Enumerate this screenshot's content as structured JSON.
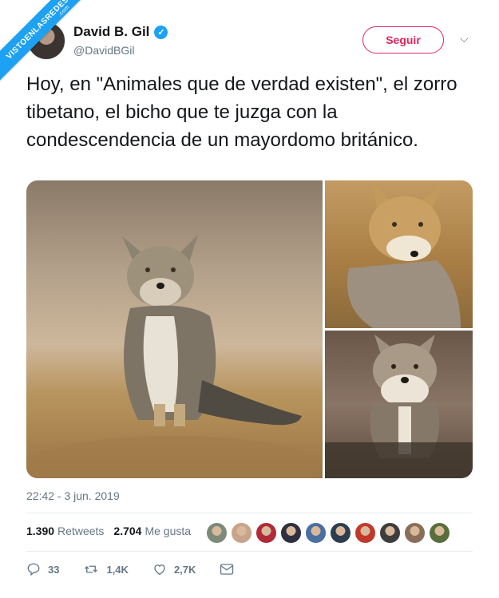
{
  "watermark": {
    "text": "VISTOENLASREDES",
    "suffix": ".com"
  },
  "author": {
    "name": "David B. Gil",
    "handle": "@DavidBGil",
    "verified_glyph": "✓",
    "avatar_icon": "user-avatar"
  },
  "follow_button": {
    "label": "Seguir"
  },
  "menu_caret": "⌵",
  "tweet": {
    "text": "Hoy, en \"Animales que de verdad existen\", el zorro tibetano, el bicho que te juzga con la condescendencia de un mayordomo británico.",
    "timestamp": "22:42 - 3 jun. 2019"
  },
  "stats": {
    "retweets_count": "1.390",
    "retweets_label": "Retweets",
    "likes_count": "2.704",
    "likes_label": "Me gusta"
  },
  "likers_colors": [
    "#7d8a7a",
    "#c9a48d",
    "#b02a3a",
    "#2f2f3f",
    "#4a6fa0",
    "#2c3e50",
    "#c0392b",
    "#3d3d3d",
    "#8a6e5a",
    "#5a6e3d"
  ],
  "actions": {
    "reply_count": "33",
    "retweet_count": "1,4K",
    "like_count": "2,7K"
  },
  "colors": {
    "accent": "#1da1f2",
    "follow": "#e0245e",
    "muted": "#657786",
    "text": "#14171a"
  }
}
